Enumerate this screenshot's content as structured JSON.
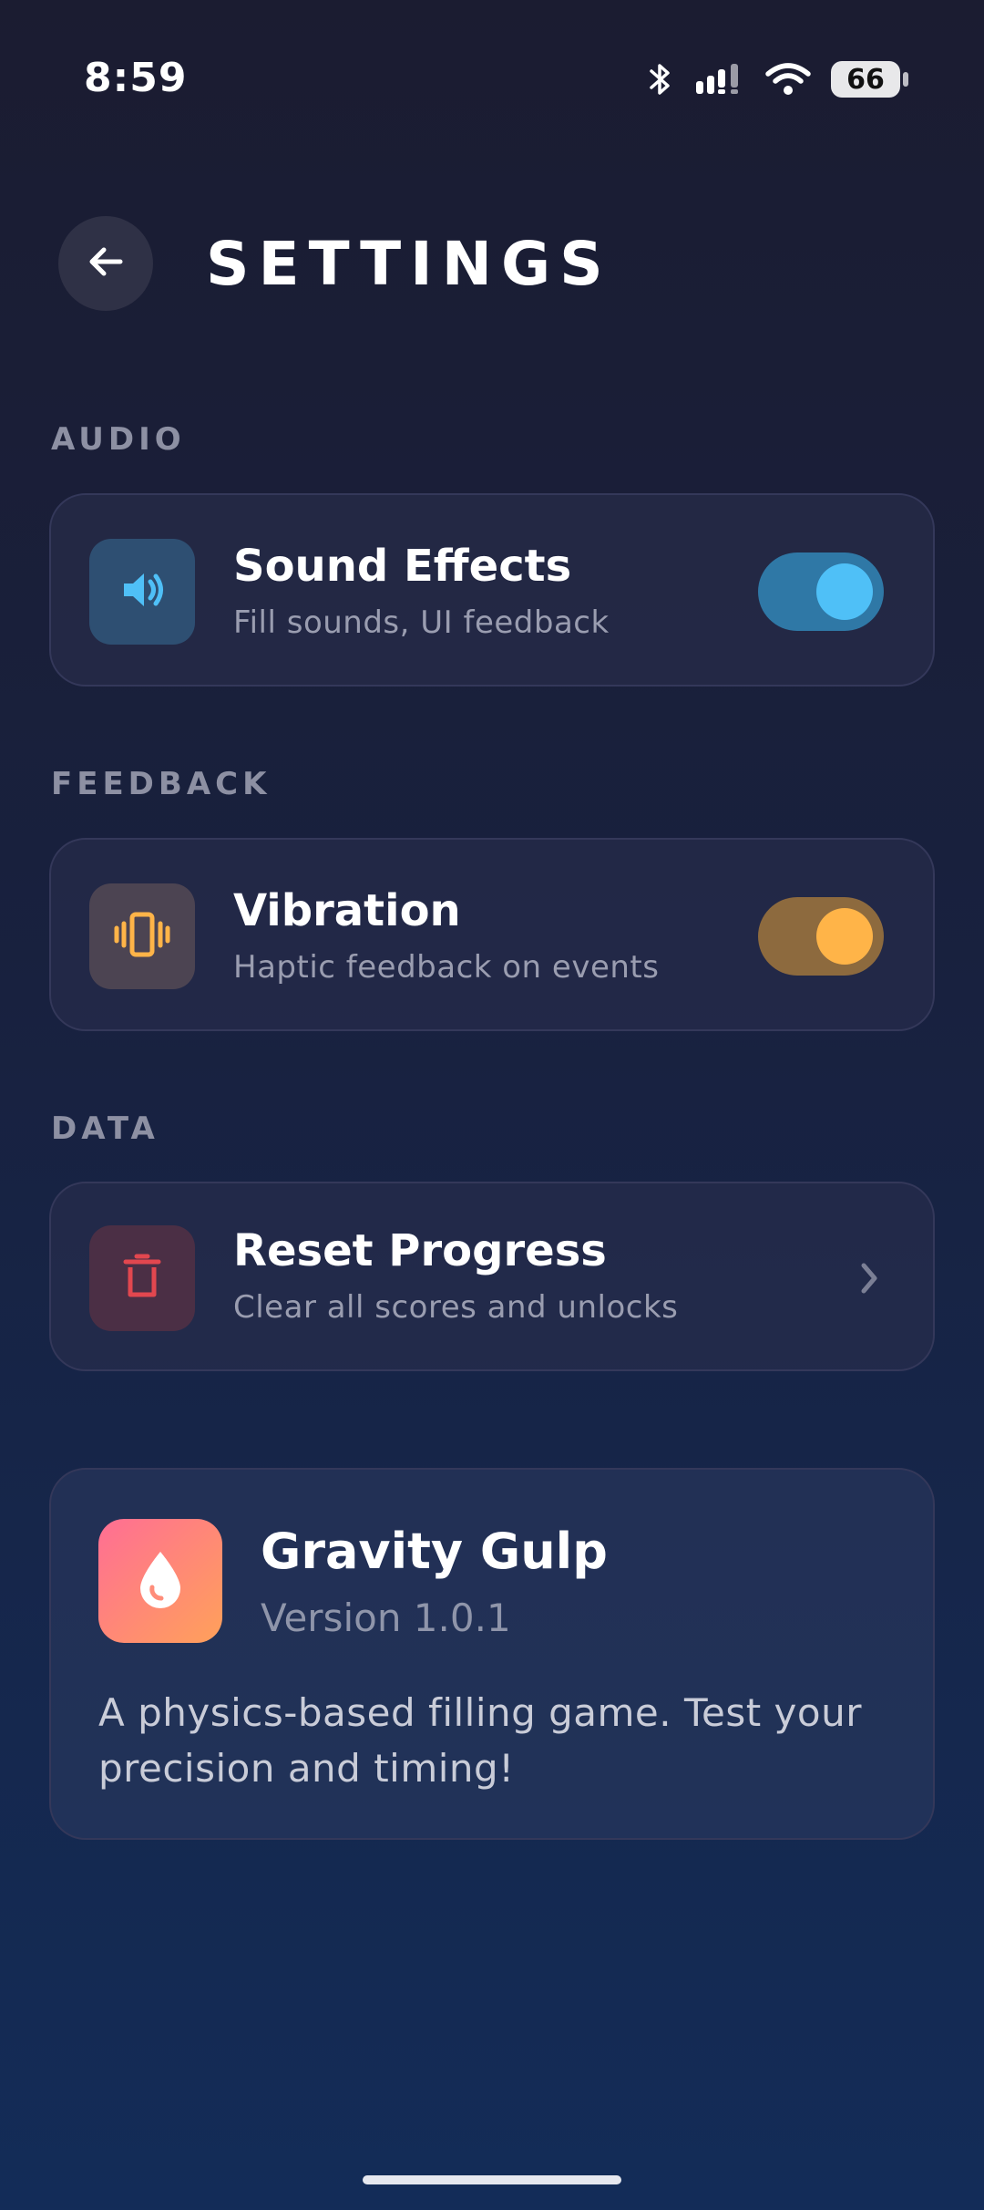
{
  "status_bar": {
    "time": "8:59",
    "battery": "66"
  },
  "header": {
    "title": "SETTINGS"
  },
  "sections": {
    "audio": {
      "label": "AUDIO",
      "title": "Sound Effects",
      "subtitle": "Fill sounds, UI feedback",
      "toggle_on": true,
      "accent": "#4fc0f7",
      "icon": "speaker-icon"
    },
    "feedback": {
      "label": "FEEDBACK",
      "title": "Vibration",
      "subtitle": "Haptic feedback on events",
      "toggle_on": true,
      "accent": "#ffb448",
      "icon": "vibration-icon"
    },
    "data": {
      "label": "DATA",
      "title": "Reset Progress",
      "subtitle": "Clear all scores and unlocks",
      "accent": "#e2474f",
      "icon": "trash-icon"
    }
  },
  "about": {
    "app_name": "Gravity Gulp",
    "version": "Version 1.0.1",
    "description": "A physics-based filling game. Test your precision and timing!",
    "icon": "droplet-icon"
  }
}
